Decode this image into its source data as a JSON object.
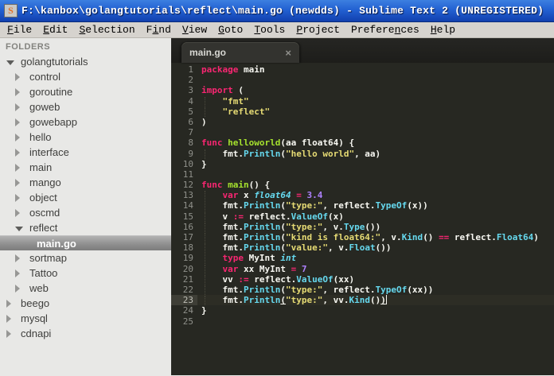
{
  "window": {
    "title": "F:\\kanbox\\golangtutorials\\reflect\\main.go (newdds) - Sublime Text 2 (UNREGISTERED)",
    "app_icon_letter": "S"
  },
  "menu": {
    "items": [
      {
        "pre": "",
        "key": "F",
        "post": "ile"
      },
      {
        "pre": "",
        "key": "E",
        "post": "dit"
      },
      {
        "pre": "",
        "key": "S",
        "post": "election"
      },
      {
        "pre": "F",
        "key": "i",
        "post": "nd"
      },
      {
        "pre": "",
        "key": "V",
        "post": "iew"
      },
      {
        "pre": "",
        "key": "G",
        "post": "oto"
      },
      {
        "pre": "",
        "key": "T",
        "post": "ools"
      },
      {
        "pre": "",
        "key": "P",
        "post": "roject"
      },
      {
        "pre": "Prefere",
        "key": "n",
        "post": "ces"
      },
      {
        "pre": "",
        "key": "H",
        "post": "elp"
      }
    ]
  },
  "sidebar": {
    "header": "FOLDERS",
    "items": [
      {
        "label": "golangtutorials",
        "level": 0,
        "state": "open",
        "selected": false
      },
      {
        "label": "control",
        "level": 1,
        "state": "closed",
        "selected": false
      },
      {
        "label": "goroutine",
        "level": 1,
        "state": "closed",
        "selected": false
      },
      {
        "label": "goweb",
        "level": 1,
        "state": "closed",
        "selected": false
      },
      {
        "label": "gowebapp",
        "level": 1,
        "state": "closed",
        "selected": false
      },
      {
        "label": "hello",
        "level": 1,
        "state": "closed",
        "selected": false
      },
      {
        "label": "interface",
        "level": 1,
        "state": "closed",
        "selected": false
      },
      {
        "label": "main",
        "level": 1,
        "state": "closed",
        "selected": false
      },
      {
        "label": "mango",
        "level": 1,
        "state": "closed",
        "selected": false
      },
      {
        "label": "object",
        "level": 1,
        "state": "closed",
        "selected": false
      },
      {
        "label": "oscmd",
        "level": 1,
        "state": "closed",
        "selected": false
      },
      {
        "label": "reflect",
        "level": 1,
        "state": "open",
        "selected": false
      },
      {
        "label": "main.go",
        "level": 2,
        "state": "file",
        "selected": true
      },
      {
        "label": "sortmap",
        "level": 1,
        "state": "closed",
        "selected": false
      },
      {
        "label": "Tattoo",
        "level": 1,
        "state": "closed",
        "selected": false
      },
      {
        "label": "web",
        "level": 1,
        "state": "closed",
        "selected": false
      },
      {
        "label": "beego",
        "level": 0,
        "state": "closed",
        "selected": false
      },
      {
        "label": "mysql",
        "level": 0,
        "state": "closed",
        "selected": false
      },
      {
        "label": "cdnapi",
        "level": 0,
        "state": "closed",
        "selected": false
      }
    ]
  },
  "editor": {
    "tab": {
      "label": "main.go",
      "close_icon": "×"
    },
    "language": "go",
    "current_line": 23,
    "lines": [
      {
        "seg": [
          {
            "t": "package",
            "c": "k"
          },
          {
            "t": " main",
            "c": "w"
          }
        ]
      },
      {
        "seg": []
      },
      {
        "seg": [
          {
            "t": "import",
            "c": "k"
          },
          {
            "t": " (",
            "c": "w"
          }
        ]
      },
      {
        "guide": true,
        "seg": [
          {
            "t": "    ",
            "c": "w"
          },
          {
            "t": "\"fmt\"",
            "c": "s"
          }
        ]
      },
      {
        "guide": true,
        "seg": [
          {
            "t": "    ",
            "c": "w"
          },
          {
            "t": "\"reflect\"",
            "c": "s"
          }
        ]
      },
      {
        "seg": [
          {
            "t": ")",
            "c": "w"
          }
        ]
      },
      {
        "seg": []
      },
      {
        "seg": [
          {
            "t": "func",
            "c": "k"
          },
          {
            "t": " ",
            "c": "w"
          },
          {
            "t": "helloworld",
            "c": "f"
          },
          {
            "t": "(aa float64) {",
            "c": "w"
          }
        ]
      },
      {
        "guide": true,
        "seg": [
          {
            "t": "    fmt.",
            "c": "w"
          },
          {
            "t": "Println",
            "c": "b"
          },
          {
            "t": "(",
            "c": "w"
          },
          {
            "t": "\"hello world\"",
            "c": "s"
          },
          {
            "t": ", aa)",
            "c": "w"
          }
        ]
      },
      {
        "seg": [
          {
            "t": "}",
            "c": "w"
          }
        ]
      },
      {
        "seg": []
      },
      {
        "seg": [
          {
            "t": "func",
            "c": "k"
          },
          {
            "t": " ",
            "c": "w"
          },
          {
            "t": "main",
            "c": "f"
          },
          {
            "t": "() {",
            "c": "w"
          }
        ]
      },
      {
        "guide": true,
        "seg": [
          {
            "t": "    ",
            "c": "w"
          },
          {
            "t": "var",
            "c": "k"
          },
          {
            "t": " x ",
            "c": "w"
          },
          {
            "t": "float64",
            "c": "t"
          },
          {
            "t": " ",
            "c": "w"
          },
          {
            "t": "=",
            "c": "k"
          },
          {
            "t": " ",
            "c": "w"
          },
          {
            "t": "3.4",
            "c": "n"
          }
        ]
      },
      {
        "guide": true,
        "seg": [
          {
            "t": "    fmt.",
            "c": "w"
          },
          {
            "t": "Println",
            "c": "b"
          },
          {
            "t": "(",
            "c": "w"
          },
          {
            "t": "\"type:\"",
            "c": "s"
          },
          {
            "t": ", reflect.",
            "c": "w"
          },
          {
            "t": "TypeOf",
            "c": "b"
          },
          {
            "t": "(x))",
            "c": "w"
          }
        ]
      },
      {
        "guide": true,
        "seg": [
          {
            "t": "    v ",
            "c": "w"
          },
          {
            "t": ":=",
            "c": "k"
          },
          {
            "t": " reflect.",
            "c": "w"
          },
          {
            "t": "ValueOf",
            "c": "b"
          },
          {
            "t": "(x)",
            "c": "w"
          }
        ]
      },
      {
        "guide": true,
        "seg": [
          {
            "t": "    fmt.",
            "c": "w"
          },
          {
            "t": "Println",
            "c": "b"
          },
          {
            "t": "(",
            "c": "w"
          },
          {
            "t": "\"type:\"",
            "c": "s"
          },
          {
            "t": ", v.",
            "c": "w"
          },
          {
            "t": "Type",
            "c": "b"
          },
          {
            "t": "())",
            "c": "w"
          }
        ]
      },
      {
        "guide": true,
        "seg": [
          {
            "t": "    fmt.",
            "c": "w"
          },
          {
            "t": "Println",
            "c": "b"
          },
          {
            "t": "(",
            "c": "w"
          },
          {
            "t": "\"kind is float64:\"",
            "c": "s"
          },
          {
            "t": ", v.",
            "c": "w"
          },
          {
            "t": "Kind",
            "c": "b"
          },
          {
            "t": "() ",
            "c": "w"
          },
          {
            "t": "==",
            "c": "k"
          },
          {
            "t": " reflect.",
            "c": "w"
          },
          {
            "t": "Float64",
            "c": "b"
          },
          {
            "t": ")",
            "c": "w"
          }
        ]
      },
      {
        "guide": true,
        "seg": [
          {
            "t": "    fmt.",
            "c": "w"
          },
          {
            "t": "Println",
            "c": "b"
          },
          {
            "t": "(",
            "c": "w"
          },
          {
            "t": "\"value:\"",
            "c": "s"
          },
          {
            "t": ", v.",
            "c": "w"
          },
          {
            "t": "Float",
            "c": "b"
          },
          {
            "t": "())",
            "c": "w"
          }
        ]
      },
      {
        "guide": true,
        "seg": [
          {
            "t": "    ",
            "c": "w"
          },
          {
            "t": "type",
            "c": "k"
          },
          {
            "t": " MyInt ",
            "c": "w"
          },
          {
            "t": "int",
            "c": "t"
          }
        ]
      },
      {
        "guide": true,
        "seg": [
          {
            "t": "    ",
            "c": "w"
          },
          {
            "t": "var",
            "c": "k"
          },
          {
            "t": " xx MyInt ",
            "c": "w"
          },
          {
            "t": "=",
            "c": "k"
          },
          {
            "t": " ",
            "c": "w"
          },
          {
            "t": "7",
            "c": "n"
          }
        ]
      },
      {
        "guide": true,
        "seg": [
          {
            "t": "    vv ",
            "c": "w"
          },
          {
            "t": ":=",
            "c": "k"
          },
          {
            "t": " reflect.",
            "c": "w"
          },
          {
            "t": "ValueOf",
            "c": "b"
          },
          {
            "t": "(xx)",
            "c": "w"
          }
        ]
      },
      {
        "guide": true,
        "seg": [
          {
            "t": "    fmt.",
            "c": "w"
          },
          {
            "t": "Println",
            "c": "b"
          },
          {
            "t": "(",
            "c": "w"
          },
          {
            "t": "\"type:\"",
            "c": "s"
          },
          {
            "t": ", reflect.",
            "c": "w"
          },
          {
            "t": "TypeOf",
            "c": "b"
          },
          {
            "t": "(xx))",
            "c": "w"
          }
        ]
      },
      {
        "guide": true,
        "cursor": true,
        "seg": [
          {
            "t": "    fmt.",
            "c": "w"
          },
          {
            "t": "Println",
            "c": "b"
          },
          {
            "t": "(",
            "c": "w u"
          },
          {
            "t": "\"type:\"",
            "c": "s"
          },
          {
            "t": ", vv.",
            "c": "w"
          },
          {
            "t": "Kind",
            "c": "b"
          },
          {
            "t": "()",
            "c": "w"
          },
          {
            "t": ")",
            "c": "w u"
          }
        ]
      },
      {
        "seg": [
          {
            "t": "}",
            "c": "w"
          }
        ]
      },
      {
        "seg": []
      }
    ]
  },
  "colors": {
    "editor_bg": "#272822",
    "keyword": "#f92672",
    "string": "#e6db74",
    "function_name": "#a6e22e",
    "builtin_call": "#66d9ef",
    "number": "#ae81ff",
    "type_italic": "#66d9ef",
    "plain_text": "#f8f8f2",
    "line_number": "#8f908a",
    "titlebar_blue_top": "#3c7fe0",
    "titlebar_blue_bottom": "#1140ae",
    "menubar_bg": "#d6d3ce",
    "sidebar_bg": "#e8e8e6"
  }
}
